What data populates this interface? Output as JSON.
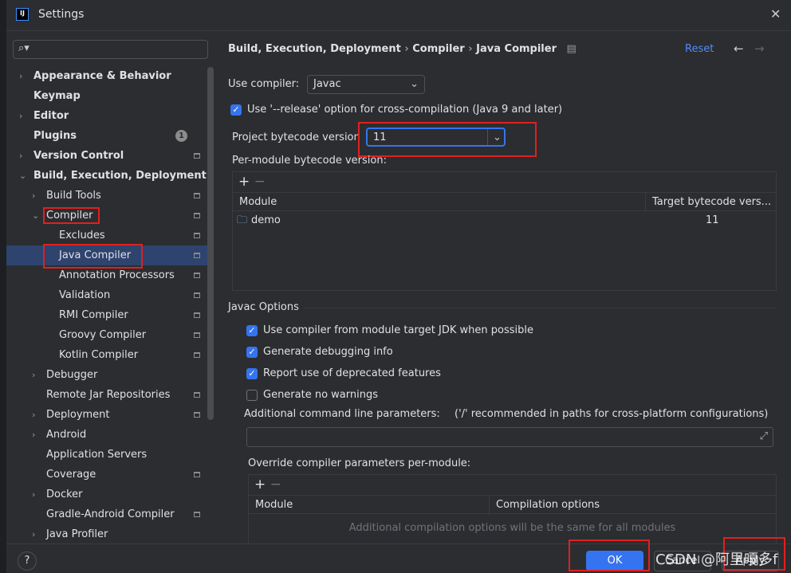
{
  "window": {
    "title": "Settings",
    "logo": "IJ"
  },
  "sidebar": {
    "items": [
      {
        "label": "Appearance & Behavior",
        "level": 0,
        "chevron": ">",
        "bold": true
      },
      {
        "label": "Keymap",
        "level": 0,
        "bold": true
      },
      {
        "label": "Editor",
        "level": 0,
        "chevron": ">",
        "bold": true
      },
      {
        "label": "Plugins",
        "level": 0,
        "bold": true,
        "badge": "1"
      },
      {
        "label": "Version Control",
        "level": 0,
        "chevron": ">",
        "bold": true,
        "pin": true
      },
      {
        "label": "Build, Execution, Deployment",
        "level": 0,
        "chevron": "v",
        "bold": true
      },
      {
        "label": "Build Tools",
        "level": 1,
        "chevron": ">",
        "pin": true
      },
      {
        "label": "Compiler",
        "level": 1,
        "chevron": "v",
        "pin": true
      },
      {
        "label": "Excludes",
        "level": 2,
        "pin": true
      },
      {
        "label": "Java Compiler",
        "level": 2,
        "pin": true,
        "selected": true
      },
      {
        "label": "Annotation Processors",
        "level": 2,
        "pin": true
      },
      {
        "label": "Validation",
        "level": 2,
        "pin": true
      },
      {
        "label": "RMI Compiler",
        "level": 2,
        "pin": true
      },
      {
        "label": "Groovy Compiler",
        "level": 2,
        "pin": true
      },
      {
        "label": "Kotlin Compiler",
        "level": 2,
        "pin": true
      },
      {
        "label": "Debugger",
        "level": 1,
        "chevron": ">"
      },
      {
        "label": "Remote Jar Repositories",
        "level": 1,
        "pin": true
      },
      {
        "label": "Deployment",
        "level": 1,
        "chevron": ">",
        "pin": true
      },
      {
        "label": "Android",
        "level": 1,
        "chevron": ">"
      },
      {
        "label": "Application Servers",
        "level": 1
      },
      {
        "label": "Coverage",
        "level": 1,
        "pin": true
      },
      {
        "label": "Docker",
        "level": 1,
        "chevron": ">"
      },
      {
        "label": "Gradle-Android Compiler",
        "level": 1,
        "pin": true
      },
      {
        "label": "Java Profiler",
        "level": 1,
        "chevron": ">"
      }
    ]
  },
  "breadcrumb": [
    "Build, Execution, Deployment",
    "Compiler",
    "Java Compiler"
  ],
  "reset": "Reset",
  "use_compiler": {
    "label": "Use compiler:",
    "value": "Javac"
  },
  "release_option": {
    "label": "Use '--release' option for cross-compilation (Java 9 and later)",
    "checked": true
  },
  "bytecode": {
    "label": "Project bytecode version",
    "value": "11"
  },
  "per_module": {
    "label": "Per-module bytecode version:",
    "columns": [
      "Module",
      "Target bytecode vers..."
    ],
    "rows": [
      {
        "module": "demo",
        "target": "11"
      }
    ]
  },
  "javac": {
    "section": "Javac Options",
    "options": [
      {
        "label": "Use compiler from module target JDK when possible",
        "checked": true
      },
      {
        "label": "Generate debugging info",
        "checked": true
      },
      {
        "label": "Report use of deprecated features",
        "checked": true
      },
      {
        "label": "Generate no warnings",
        "checked": false
      }
    ],
    "cmd_label": "Additional command line parameters:",
    "cmd_hint": "('/' recommended in paths for cross-platform configurations)",
    "override_label": "Override compiler parameters per-module:",
    "override_columns": [
      "Module",
      "Compilation options"
    ],
    "override_empty": "Additional compilation options will be the same for all modules"
  },
  "buttons": {
    "ok": "OK",
    "cancel": "Cancel",
    "apply": "Apply",
    "help": "?"
  },
  "watermark": "CSDN @阿里嘎多f",
  "colors": {
    "accent": "#3574f0",
    "link": "#548af7",
    "highlight": "#e02020",
    "selection": "#2e436e"
  }
}
